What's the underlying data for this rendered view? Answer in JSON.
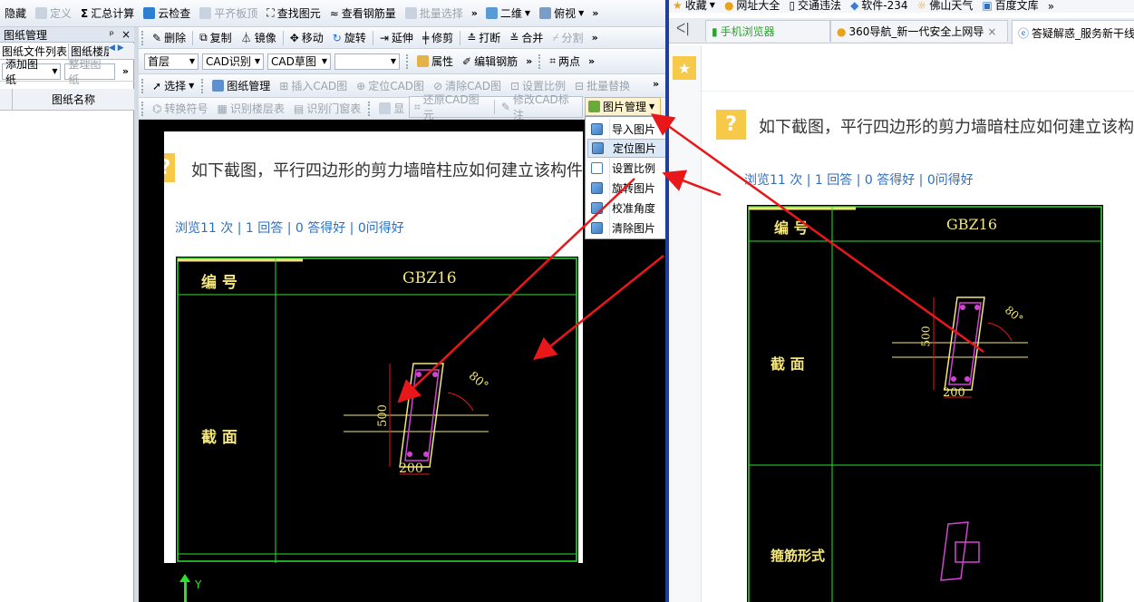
{
  "app": {
    "toolbar1": {
      "hide": "隐藏",
      "define": "定义",
      "summary": "汇总计算",
      "cloud_check": "云检查",
      "align_top": "平齐板顶",
      "find_element": "查找图元",
      "view_rebar": "查看钢筋量",
      "batch_select": "批量选择",
      "view_2d": "二维",
      "view_mode": "俯视",
      "more": "»"
    },
    "panel": {
      "title": "图纸管理",
      "pin": "ᵖ",
      "close": "×",
      "tab_files": "图纸文件列表",
      "tab_floor": "图纸楼层",
      "add_drawing": "添加图纸",
      "organize": "整理图纸",
      "col_name": "图纸名称"
    },
    "toolbar2": {
      "delete": "删除",
      "copy": "复制",
      "mirror": "镜像",
      "move": "移动",
      "rotate": "旋转",
      "extend": "延伸",
      "trim": "修剪",
      "break": "打断",
      "merge": "合并",
      "split": "分割"
    },
    "toolbar3": {
      "floor": "首层",
      "cad_recognize": "CAD识别",
      "cad_sketch": "CAD草图",
      "blank": "",
      "properties": "属性",
      "edit_rebar": "编辑钢筋",
      "two_points": "两点"
    },
    "toolbar4": {
      "select": "选择",
      "drawing_mgmt": "图纸管理",
      "insert_cad": "插入CAD图",
      "locate_cad": "定位CAD图",
      "clear_cad": "清除CAD图",
      "set_scale": "设置比例",
      "batch_replace": "批量替换"
    },
    "toolbar5": {
      "convert_symbol": "转换符号",
      "recognize_floor_table": "识别楼层表",
      "recognize_door_table": "识别门窗表",
      "show": "显",
      "restore_cad": "还原CAD图元",
      "modify_cad_label": "修改CAD标注",
      "image_mgmt": "图片管理"
    },
    "image_menu": {
      "items": [
        "导入图片",
        "定位图片",
        "设置比例",
        "旋转图片",
        "校准角度",
        "清除图片"
      ]
    },
    "axis_y": "Y"
  },
  "browser": {
    "bookmarks": [
      "收藏",
      "网址大全",
      "交通违法",
      "软件-234",
      "佛山天气",
      "百度文库"
    ],
    "tabs": [
      "手机浏览器",
      "360导航_新一代安全上网导",
      "答疑解惑_服务新干线"
    ],
    "question_title": "如下截图，平行四边形的剪力墙暗柱应如何建立该构件",
    "stats": "浏览11 次 | 1 回答 | 0 答得好 | 0问得好"
  },
  "cad": {
    "col_id": "编 号",
    "col_val": "GBZ16",
    "row_section": "截 面",
    "row_stirrup": "箍筋形式",
    "dim_500": "500",
    "dim_200": "200",
    "angle": "80°"
  },
  "colors": {
    "arrow": "#e8171a",
    "cad_green": "#2ee02e",
    "cad_yellow": "#f4e67a",
    "link_blue": "#2f6fc0",
    "accent_yellow": "#f7c948"
  }
}
